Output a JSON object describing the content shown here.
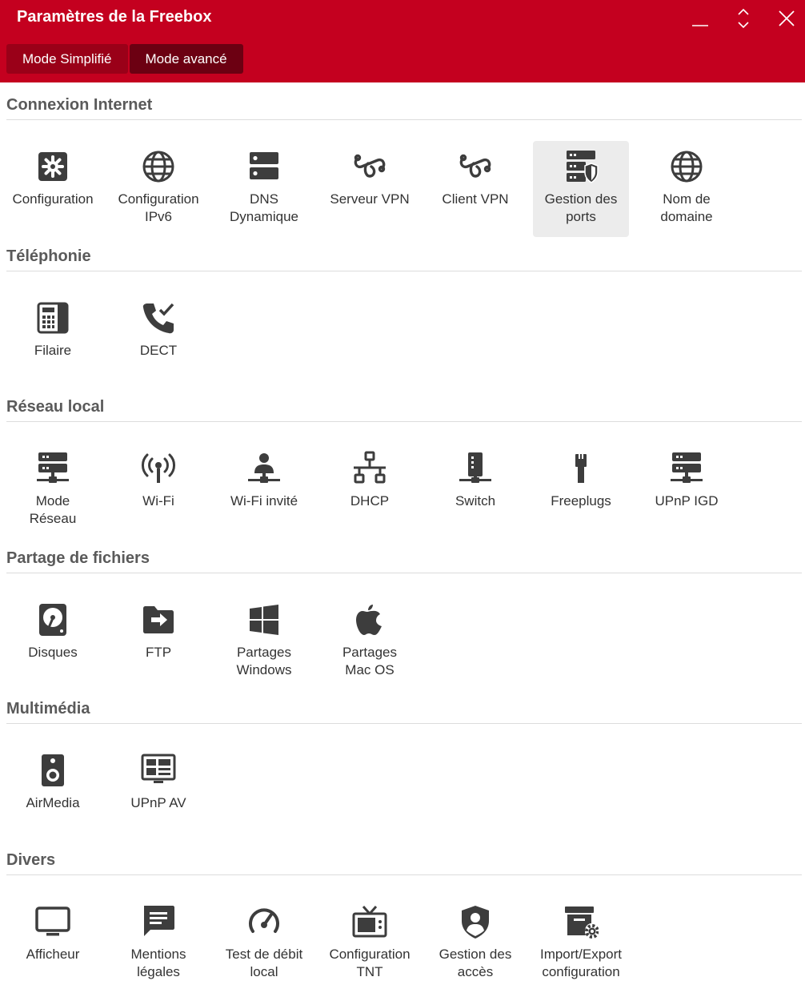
{
  "window": {
    "title": "Paramètres de la Freebox",
    "accent_color": "#c4001f",
    "controls": [
      "minimize-icon",
      "restore-icon",
      "close-icon"
    ]
  },
  "modes": [
    {
      "label": "Mode Simplifié",
      "active": false
    },
    {
      "label": "Mode avancé",
      "active": true
    }
  ],
  "sections": [
    {
      "title": "Connexion Internet",
      "items": [
        {
          "label": "Configuration",
          "icon": "gear-icon"
        },
        {
          "label": "Configuration\nIPv6",
          "icon": "globe-icon"
        },
        {
          "label": "DNS\nDynamique",
          "icon": "server-icon"
        },
        {
          "label": "Serveur VPN",
          "icon": "vpn-icon"
        },
        {
          "label": "Client VPN",
          "icon": "vpn-icon"
        },
        {
          "label": "Gestion des\nports",
          "icon": "server-shield-icon",
          "selected": true
        },
        {
          "label": "Nom de\ndomaine",
          "icon": "globe-icon"
        }
      ]
    },
    {
      "title": "Téléphonie",
      "items": [
        {
          "label": "Filaire",
          "icon": "desk-phone-icon"
        },
        {
          "label": "DECT",
          "icon": "phone-check-icon"
        }
      ]
    },
    {
      "title": "Réseau local",
      "items": [
        {
          "label": "Mode\nRéseau",
          "icon": "network-server-icon"
        },
        {
          "label": "Wi-Fi",
          "icon": "wifi-antenna-icon"
        },
        {
          "label": "Wi-Fi invité",
          "icon": "guest-user-icon"
        },
        {
          "label": "DHCP",
          "icon": "network-tree-icon"
        },
        {
          "label": "Switch",
          "icon": "switch-icon"
        },
        {
          "label": "Freeplugs",
          "icon": "plug-icon"
        },
        {
          "label": "UPnP IGD",
          "icon": "network-server-icon"
        }
      ]
    },
    {
      "title": "Partage de fichiers",
      "items": [
        {
          "label": "Disques",
          "icon": "hard-disk-icon"
        },
        {
          "label": "FTP",
          "icon": "folder-arrow-icon"
        },
        {
          "label": "Partages\nWindows",
          "icon": "windows-icon"
        },
        {
          "label": "Partages\nMac OS",
          "icon": "apple-icon"
        }
      ]
    },
    {
      "title": "Multimédia",
      "items": [
        {
          "label": "AirMedia",
          "icon": "speaker-icon"
        },
        {
          "label": "UPnP AV",
          "icon": "media-screen-icon"
        }
      ]
    },
    {
      "title": "Divers",
      "items": [
        {
          "label": "Afficheur",
          "icon": "monitor-icon"
        },
        {
          "label": "Mentions\nlégales",
          "icon": "message-icon"
        },
        {
          "label": "Test de débit\nlocal",
          "icon": "speedometer-icon"
        },
        {
          "label": "Configuration\nTNT",
          "icon": "tv-icon"
        },
        {
          "label": "Gestion des\naccès",
          "icon": "shield-user-icon"
        },
        {
          "label": "Import/Export\nconfiguration",
          "icon": "archive-gear-icon"
        }
      ]
    }
  ]
}
